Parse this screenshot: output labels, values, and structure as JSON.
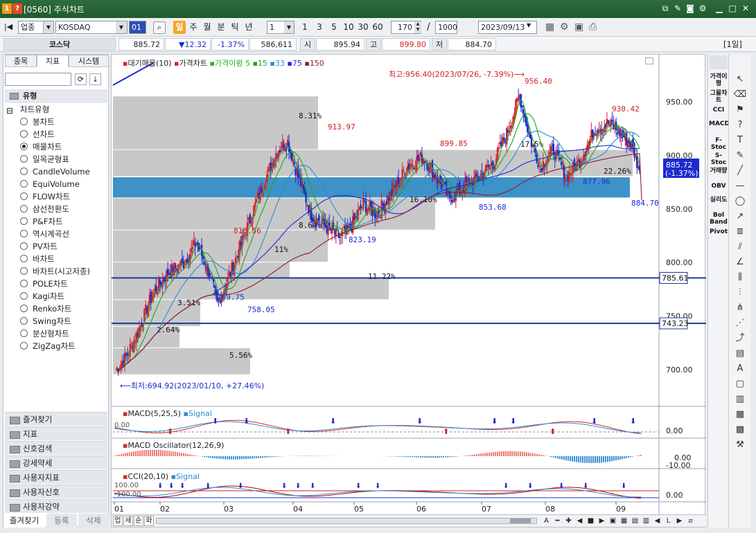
{
  "window": {
    "code": "[0560]",
    "title": "주식차트",
    "icon1": "1",
    "icon2": "?"
  },
  "toolbar": {
    "market_type": "업종",
    "symbol": "KOSDAQ",
    "code_box": "01",
    "period_buttons": [
      "일",
      "주",
      "월",
      "분",
      "틱",
      "년"
    ],
    "active_period": "일",
    "interval_value": "1",
    "quick_intervals": [
      "1",
      "3",
      "5",
      "10",
      "30",
      "60"
    ],
    "count": "170",
    "separator": "/",
    "max_count": "1000",
    "date": "2023/09/13"
  },
  "quote": {
    "name": "코스닥",
    "price": "885.72",
    "change": "▼12.32",
    "change_pct": "-1.37%",
    "volume": "586,611",
    "open_label": "시",
    "open": "895.94",
    "high_label": "고",
    "high": "899.80",
    "low_label": "저",
    "low": "884.70",
    "period_badge": "[1일]"
  },
  "left_panel": {
    "tabs": [
      "종목",
      "지표",
      "시스템"
    ],
    "active_tab": "지표",
    "tree_root": "유형",
    "tree_group": "차트유형",
    "chart_types": [
      "봉차트",
      "선차트",
      "매물차트",
      "일목균형표",
      "CandleVolume",
      "EquiVolume",
      "FLOW차트",
      "삼선전환도",
      "P&F차트",
      "역시계곡선",
      "PV차트",
      "바차트",
      "바차트(시고저종)",
      "POLE차트",
      "Kagi차트",
      "Renko차트",
      "Swing차트",
      "분산형차트",
      "ZigZag차트"
    ],
    "selected_type": "매물차트",
    "folders": [
      "즐겨찾기",
      "지표",
      "신호검색",
      "강세약세",
      "사용자지표",
      "사용자신호",
      "사용자강약"
    ],
    "bottom_tabs": [
      "즐겨찾기",
      "등록",
      "삭제"
    ]
  },
  "chart": {
    "legend": {
      "vol_profile": "대기매물(10)",
      "price": "가격차트",
      "env": "가격이평",
      "ma5": "5",
      "ma15": "15",
      "ma33": "33",
      "ma75": "75",
      "ma150": "150"
    },
    "colors": {
      "up": "#d6262c",
      "down": "#1a2bd0",
      "ma5": "#27b027",
      "ma15": "#18a818",
      "ma33": "#2a8bd2",
      "ma75": "#1a2bd0",
      "ma150": "#8a1e2c",
      "profile": "#c8c8c8",
      "profile_hi": "#3d92c7",
      "hline": "#1a3a9a"
    },
    "annotations": {
      "high_note": "최고:956.40(2023/07/26, -7.39%)⟶",
      "low_note": "⟵최저:694.92(2023/01/10, +27.46%)",
      "price_labels": [
        {
          "t": "956.40",
          "c": "#c22"
        },
        {
          "t": "930.42",
          "c": "#c22"
        },
        {
          "t": "913.97",
          "c": "#c22"
        },
        {
          "t": "899.85",
          "c": "#c22"
        },
        {
          "t": "818.56",
          "c": "#c22"
        },
        {
          "t": "877.96",
          "c": "#1a2bd0"
        },
        {
          "t": "853.68",
          "c": "#1a2bd0"
        },
        {
          "t": "823.19",
          "c": "#1a2bd0"
        },
        {
          "t": "769.75",
          "c": "#1a2bd0"
        },
        {
          "t": "758.05",
          "c": "#1a2bd0"
        },
        {
          "t": "884.70",
          "c": "#1a2bd0"
        }
      ],
      "profile_pcts": [
        "8.31%",
        "17.5%",
        "22.26%",
        "16.10%",
        "8.64%",
        "11%",
        "11.22%",
        "3.51%",
        "2.64%",
        "5.56%"
      ]
    },
    "y_ticks": [
      "950.00",
      "900.00",
      "850.00",
      "800.00",
      "750.00",
      "700.00"
    ],
    "hlines": [
      "785.61",
      "743.23"
    ],
    "current_price": "885.72",
    "current_pct": "(-1.37%)",
    "x_ticks": [
      "01",
      "02",
      "03",
      "04",
      "05",
      "06",
      "07",
      "08",
      "09"
    ],
    "macd": {
      "title": "MACD(5,25,5)",
      "signal": "Signal",
      "zero": "0.00",
      "y": "0.00"
    },
    "osc": {
      "title": "MACD Oscillator(12,26,9)",
      "y1": "0.00",
      "y2": "-10.00"
    },
    "cci": {
      "title": "CCI(20,10)",
      "signal": "Signal",
      "l1": "100.00",
      "l2": "-100.00",
      "y": "0.00"
    },
    "bottom_bar": [
      "업",
      "세",
      "순",
      "화"
    ]
  },
  "right_indicators": [
    "가격이평",
    "그물차트",
    "CCI",
    "MACD",
    "F-Stoc",
    "S-Stoc",
    "거래량",
    "OBV",
    "실리도",
    "Bol Band",
    "Pivot"
  ]
}
